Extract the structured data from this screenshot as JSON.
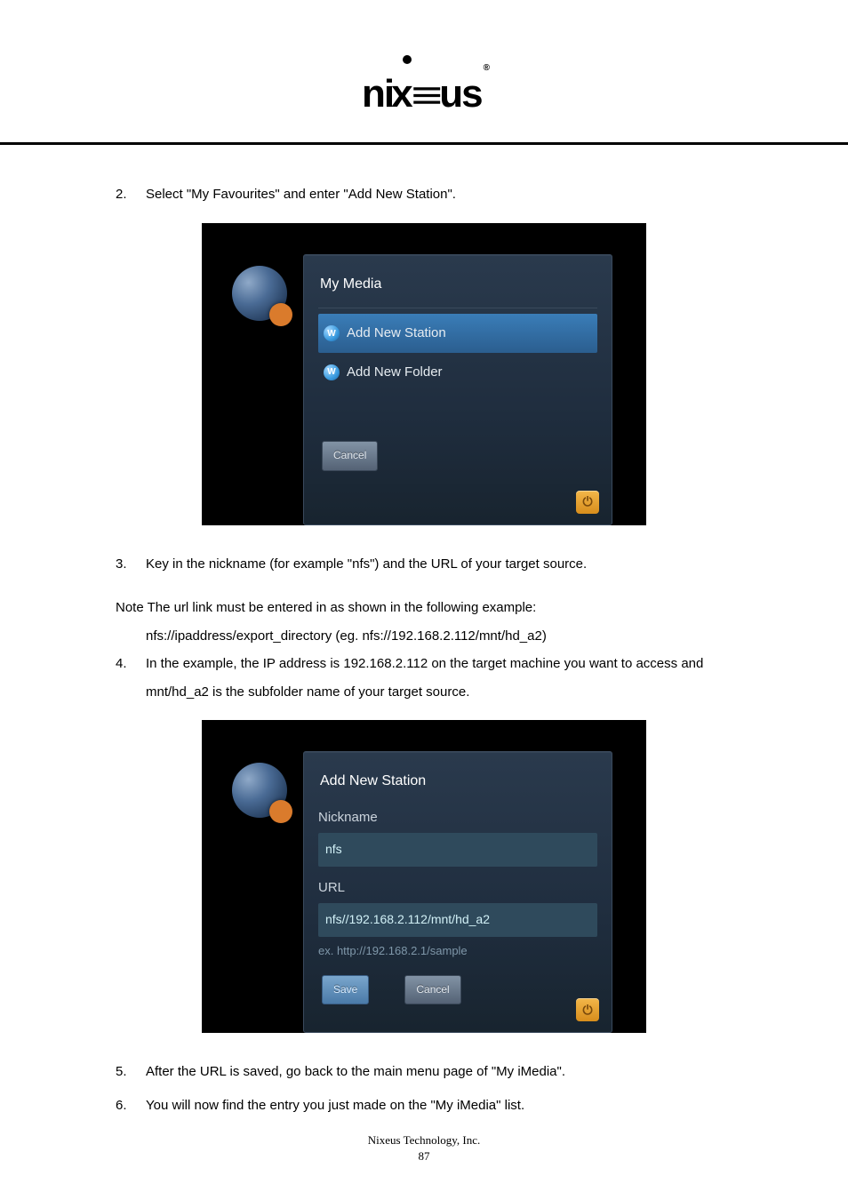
{
  "logo": {
    "text": "nixeus",
    "reg": "®"
  },
  "steps": {
    "s2": {
      "num": "2.",
      "text": "Select \"My Favourites\" and enter \"Add New Station\"."
    },
    "s3": {
      "num": "3.",
      "text": "Key in the nickname (for example \"nfs\") and the URL of your target source."
    },
    "s4": {
      "num": "4.",
      "text": "In the example, the IP address is 192.168.2.112 on the target machine you want to access and mnt/hd_a2 is the subfolder name of your target source."
    },
    "s5": {
      "num": "5.",
      "text": "After the URL is saved, go back to the main menu page of \"My iMedia\"."
    },
    "s6": {
      "num": "6.",
      "text": "You will now find the entry you just made on the \"My iMedia\" list."
    }
  },
  "note": {
    "line1": "Note The url link must be entered in as shown in the following example:",
    "line2": "nfs://ipaddress/export_directory (eg. nfs://192.168.2.112/mnt/hd_a2)"
  },
  "shot1": {
    "title": "My Media",
    "row1": "Add New Station",
    "row2": "Add New Folder",
    "cancel": "Cancel",
    "w": "W"
  },
  "shot2": {
    "title": "Add New Station",
    "nickname_label": "Nickname",
    "nickname_value": "nfs",
    "url_label": "URL",
    "url_value": "nfs//192.168.2.112/mnt/hd_a2",
    "hint": "ex. http://192.168.2.1/sample",
    "save": "Save",
    "cancel": "Cancel",
    "w": "W"
  },
  "footer": {
    "company": "Nixeus Technology, Inc.",
    "page": "87"
  }
}
